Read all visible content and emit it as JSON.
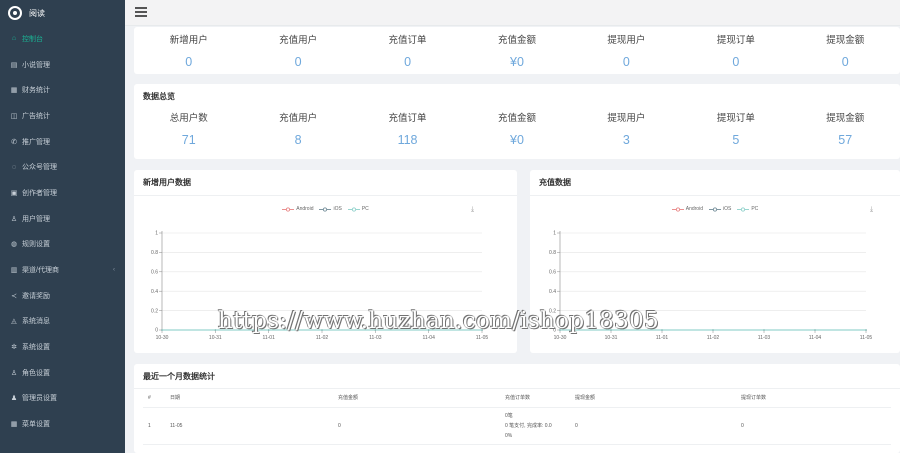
{
  "brand": {
    "name": "阅读"
  },
  "sidebar": {
    "items": [
      {
        "label": "控制台",
        "icon": "home-icon",
        "active": true
      },
      {
        "label": "小说管理",
        "icon": "book-icon"
      },
      {
        "label": "财务统计",
        "icon": "finance-icon"
      },
      {
        "label": "广告统计",
        "icon": "ad-icon"
      },
      {
        "label": "推广管理",
        "icon": "promote-icon"
      },
      {
        "label": "公众号管理",
        "icon": "wechat-icon"
      },
      {
        "label": "创作者管理",
        "icon": "author-icon"
      },
      {
        "label": "用户管理",
        "icon": "user-icon"
      },
      {
        "label": "规则设置",
        "icon": "rule-icon"
      },
      {
        "label": "渠道/代理商",
        "icon": "channel-icon",
        "caret": true
      },
      {
        "label": "邀请奖励",
        "icon": "share-icon"
      },
      {
        "label": "系统消息",
        "icon": "bell-icon"
      },
      {
        "label": "系统设置",
        "icon": "settings-icon"
      },
      {
        "label": "角色设置",
        "icon": "role-icon"
      },
      {
        "label": "管理员设置",
        "icon": "admin-icon"
      },
      {
        "label": "菜单设置",
        "icon": "menu-icon"
      }
    ]
  },
  "today": {
    "stats": [
      {
        "label": "新增用户",
        "value": "0"
      },
      {
        "label": "充值用户",
        "value": "0"
      },
      {
        "label": "充值订单",
        "value": "0"
      },
      {
        "label": "充值金额",
        "value": "¥0"
      },
      {
        "label": "提现用户",
        "value": "0"
      },
      {
        "label": "提现订单",
        "value": "0"
      },
      {
        "label": "提现金额",
        "value": "0"
      }
    ]
  },
  "overview": {
    "title": "数据总览",
    "stats": [
      {
        "label": "总用户数",
        "value": "71"
      },
      {
        "label": "充值用户",
        "value": "8"
      },
      {
        "label": "充值订单",
        "value": "118"
      },
      {
        "label": "充值金额",
        "value": "¥0"
      },
      {
        "label": "提现用户",
        "value": "3"
      },
      {
        "label": "提现订单",
        "value": "5"
      },
      {
        "label": "提现金额",
        "value": "57"
      }
    ]
  },
  "charts": {
    "new_users_title": "新增用户数据",
    "recharge_title": "充值数据",
    "legend": [
      {
        "name": "Android",
        "color": "#e57373"
      },
      {
        "name": "iOS",
        "color": "#607d8b"
      },
      {
        "name": "PC",
        "color": "#80cbc4"
      }
    ]
  },
  "chart_data": [
    {
      "type": "line",
      "title": "新增用户数据",
      "x": [
        "10-30",
        "10-31",
        "11-01",
        "11-02",
        "11-03",
        "11-04",
        "11-05"
      ],
      "y_ticks": [
        "0",
        "0.2",
        "0.4",
        "0.6",
        "0.8",
        "1"
      ],
      "ylim": [
        0,
        1
      ],
      "grid": true,
      "legend_position": "top",
      "series": [
        {
          "name": "Android",
          "values": [
            0,
            0,
            0,
            0,
            0,
            0,
            0
          ]
        },
        {
          "name": "iOS",
          "values": [
            0,
            0,
            0,
            0,
            0,
            0,
            0
          ]
        },
        {
          "name": "PC",
          "values": [
            0,
            0,
            0,
            0,
            0,
            0,
            0
          ]
        }
      ]
    },
    {
      "type": "line",
      "title": "充值数据",
      "x": [
        "10-30",
        "10-31",
        "11-01",
        "11-02",
        "11-03",
        "11-04",
        "11-05"
      ],
      "y_ticks": [
        "0",
        "0.2",
        "0.4",
        "0.6",
        "0.8",
        "1"
      ],
      "ylim": [
        0,
        1
      ],
      "grid": true,
      "legend_position": "top",
      "series": [
        {
          "name": "Android",
          "values": [
            0,
            0,
            0,
            0,
            0,
            0,
            0
          ]
        },
        {
          "name": "iOS",
          "values": [
            0,
            0,
            0,
            0,
            0,
            0,
            0
          ]
        },
        {
          "name": "PC",
          "values": [
            0,
            0,
            0,
            0,
            0,
            0,
            0
          ]
        }
      ]
    }
  ],
  "monthly": {
    "title": "最近一个月数据统计",
    "columns": [
      "#",
      "日期",
      "充值金额",
      "充值订单数",
      "提现金额",
      "提现订单数"
    ],
    "rows": [
      {
        "idx": "1",
        "date": "11-05",
        "amount": "0",
        "orders_line1": "0笔",
        "orders_line2": "0 笔支付, 完成率: 0.0",
        "orders_line3": "0%",
        "withdraw_amount": "0",
        "withdraw_orders": "0"
      }
    ]
  },
  "watermark": "https://www.huzhan.com/ishop18305"
}
